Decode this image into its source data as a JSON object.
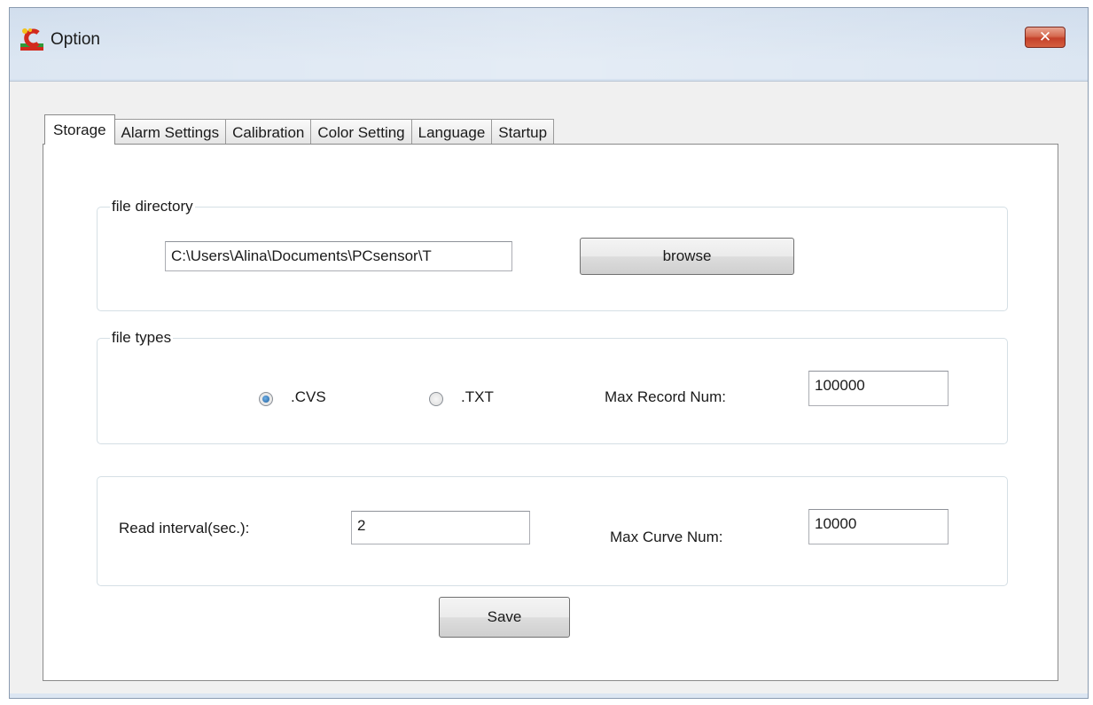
{
  "window": {
    "title": "Option",
    "app_icon": "pcsensor-c-icon",
    "close_glyph": "✕"
  },
  "tabs": [
    {
      "label": "Storage",
      "active": true
    },
    {
      "label": "Alarm Settings",
      "active": false
    },
    {
      "label": "Calibration",
      "active": false
    },
    {
      "label": "Color Setting",
      "active": false
    },
    {
      "label": "Language",
      "active": false
    },
    {
      "label": "Startup",
      "active": false
    }
  ],
  "file_directory": {
    "group_label": "file directory",
    "path_value": "C:\\Users\\Alina\\Documents\\PCsensor\\T",
    "browse_label": "browse"
  },
  "file_types": {
    "group_label": "file types",
    "options": [
      {
        "label": ".CVS",
        "checked": true
      },
      {
        "label": ".TXT",
        "checked": false
      }
    ],
    "max_record_label": "Max Record Num:",
    "max_record_value": "100000"
  },
  "interval": {
    "read_interval_label": "Read interval(sec.):",
    "read_interval_value": "2",
    "max_curve_label": "Max Curve Num:",
    "max_curve_value": "10000"
  },
  "save_label": "Save",
  "colors": {
    "close_button": "#c4412a",
    "radio_checked": "#1f5f9e",
    "titlebar": "#c9d8ea"
  }
}
